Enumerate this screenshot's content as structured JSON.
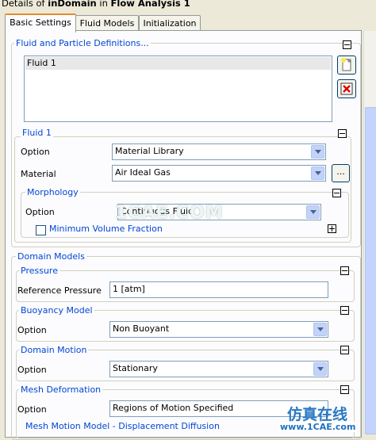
{
  "window": {
    "title_prefix": "Details of ",
    "title_object": "inDomain",
    "title_middle": " in ",
    "title_context": "Flow Analysis 1"
  },
  "tabs": [
    {
      "label": "Basic Settings",
      "active": true
    },
    {
      "label": "Fluid Models",
      "active": false
    },
    {
      "label": "Initialization",
      "active": false
    }
  ],
  "fluid_defs": {
    "title": "Fluid and Particle Definitions...",
    "items": [
      "Fluid 1"
    ]
  },
  "fluid1": {
    "title": "Fluid 1",
    "option_label": "Option",
    "option_value": "Material Library",
    "material_label": "Material",
    "material_value": "Air Ideal Gas",
    "browse_label": "...",
    "morphology": {
      "title": "Morphology",
      "option_label": "Option",
      "option_value": "Continuous Fluid",
      "min_volume_fraction_label": "Minimum Volume Fraction"
    }
  },
  "domain_models": {
    "title": "Domain Models",
    "pressure": {
      "title": "Pressure",
      "ref_label": "Reference Pressure",
      "ref_value": "1 [atm]"
    },
    "buoyancy": {
      "title": "Buoyancy Model",
      "option_label": "Option",
      "option_value": "Non Buoyant"
    },
    "motion": {
      "title": "Domain Motion",
      "option_label": "Option",
      "option_value": "Stationary"
    },
    "mesh_deformation": {
      "title": "Mesh Deformation",
      "option_label": "Option",
      "option_value": "Regions of Motion Specified"
    },
    "mesh_motion_model": {
      "title": "Mesh Motion Model - Displacement Diffusion"
    }
  },
  "watermark": {
    "text": "1CAE.COM",
    "brand_cn": "仿真在线",
    "brand_url": "www.1CAE.com"
  },
  "colors": {
    "group_label": "#0046d5",
    "active_tab_accent": "#e68b2c",
    "panel_bg": "#fcfcfe",
    "window_bg": "#ece9d8"
  }
}
